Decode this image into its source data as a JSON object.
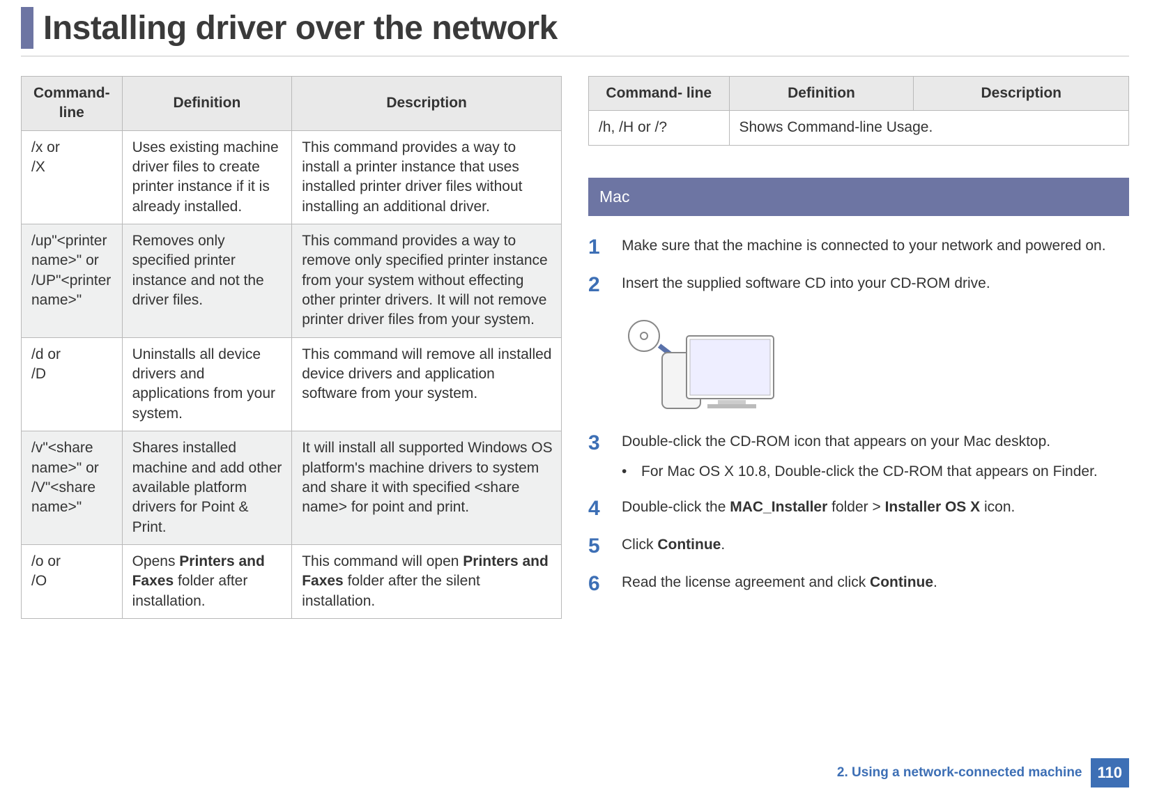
{
  "title": "Installing driver over the network",
  "table1": {
    "headers": [
      "Command- line",
      "Definition",
      "Description"
    ],
    "rows": [
      {
        "cmd_a": "/x or",
        "cmd_b": "/X",
        "def": "Uses existing machine driver files to create printer instance if it is already installed.",
        "desc": "This command provides a way to install a printer instance that uses installed printer driver files without installing an additional driver."
      },
      {
        "cmd_a": "/up\"<printer name>\" or",
        "cmd_b": "/UP\"<printer name>\"",
        "def": "Removes only specified printer instance and not the driver files.",
        "desc": "This command provides a way to remove only specified printer instance from your system without effecting other printer drivers. It will not remove printer driver files from your system."
      },
      {
        "cmd_a": "/d or",
        "cmd_b": "/D",
        "def": "Uninstalls all device drivers and applications from your system.",
        "desc": "This command will remove all installed device drivers and application software from your system."
      },
      {
        "cmd_a": "/v\"<share name>\" or",
        "cmd_b": "/V\"<share name>\"",
        "def": "Shares installed machine and add other available platform drivers for Point & Print.",
        "desc": "It will install all supported Windows OS platform's machine drivers to system and share it with specified <share name> for point and print."
      },
      {
        "cmd_a": "/o or",
        "cmd_b": "/O",
        "def_pre": "Opens ",
        "def_bold": "Printers and Faxes",
        "def_post": " folder after installation.",
        "desc_pre": "This command will open ",
        "desc_bold": "Printers and Faxes",
        "desc_post": " folder after the silent installation."
      }
    ]
  },
  "table2": {
    "headers": [
      "Command- line",
      "Definition",
      "Description"
    ],
    "rows": [
      {
        "cmd": "/h, /H or /?",
        "def": "Shows Command-line Usage."
      }
    ]
  },
  "section_heading": "Mac",
  "steps": [
    {
      "n": "1",
      "t": "Make sure that the machine is connected to your network and powered on."
    },
    {
      "n": "2",
      "t": "Insert the supplied software CD into your CD-ROM drive."
    },
    {
      "n": "3",
      "t": "Double-click the CD-ROM icon that appears on your Mac desktop.",
      "sub": "For Mac OS X 10.8, Double-click the CD-ROM that appears on Finder."
    },
    {
      "n": "4",
      "t_pre": "Double-click the ",
      "t_b1": "MAC_Installer",
      "t_mid": " folder > ",
      "t_b2": "Installer OS X",
      "t_post": " icon."
    },
    {
      "n": "5",
      "t_pre": " Click ",
      "t_b1": "Continue",
      "t_post": "."
    },
    {
      "n": "6",
      "t_pre": "Read the license agreement and click ",
      "t_b1": "Continue",
      "t_post": "."
    }
  ],
  "footer": {
    "section": "2.  Using a network-connected machine",
    "page": "110"
  }
}
